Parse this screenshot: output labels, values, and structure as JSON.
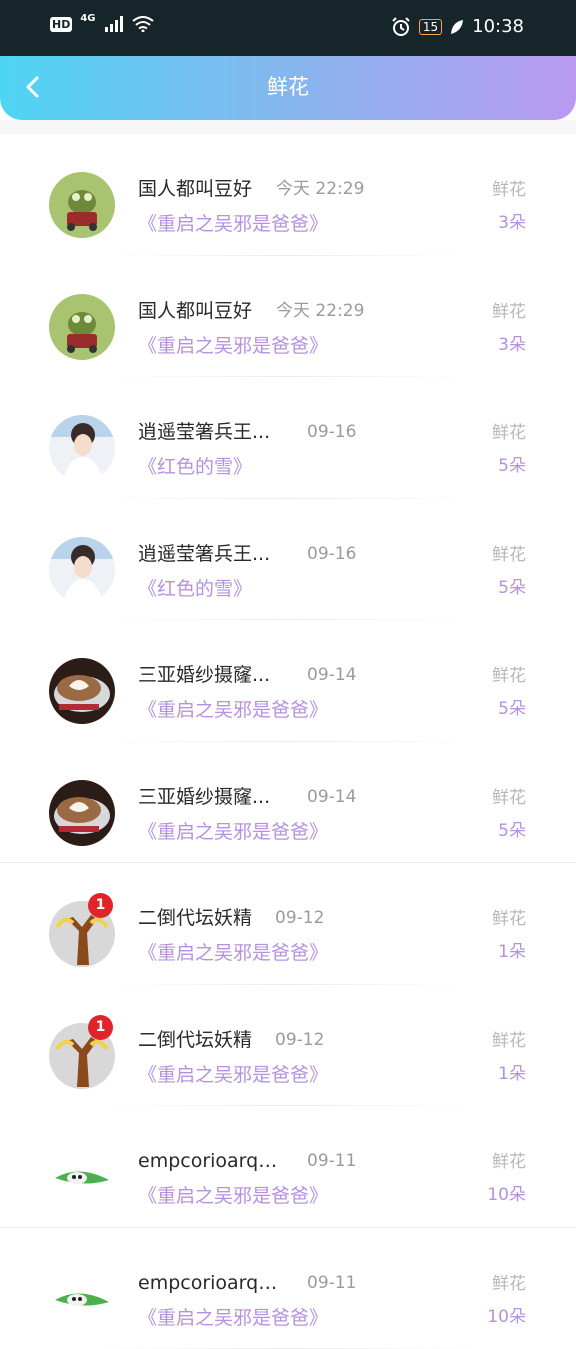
{
  "status_bar": {
    "left_badges": [
      "HD",
      "4G"
    ],
    "battery": "15",
    "time": "10:38"
  },
  "header": {
    "title": "鲜花"
  },
  "list": [
    {
      "name": "国人都叫豆好",
      "time": "今天 22:29",
      "book": "《重启之吴邪是爸爸》",
      "label": "鲜花",
      "count": "3朵",
      "avatar": "frog-avatar"
    },
    {
      "name": "国人都叫豆好",
      "time": "今天 22:29",
      "book": "《重启之吴邪是爸爸》",
      "label": "鲜花",
      "count": "3朵",
      "avatar": "frog-avatar"
    },
    {
      "name": "逍遥莹箸兵王...",
      "time": "09-16",
      "book": "《红色的雪》",
      "label": "鲜花",
      "count": "5朵",
      "avatar": "girl-avatar"
    },
    {
      "name": "逍遥莹箸兵王...",
      "time": "09-16",
      "book": "《红色的雪》",
      "label": "鲜花",
      "count": "5朵",
      "avatar": "girl-avatar"
    },
    {
      "name": "三亚婚纱摄窿...",
      "time": "09-14",
      "book": "《重启之吴邪是爸爸》",
      "label": "鲜花",
      "count": "5朵",
      "avatar": "coffee-avatar"
    },
    {
      "name": "三亚婚纱摄窿...",
      "time": "09-14",
      "book": "《重启之吴邪是爸爸》",
      "label": "鲜花",
      "count": "5朵",
      "avatar": "coffee-avatar"
    },
    {
      "name": "二倒代坛妖精",
      "time": "09-12",
      "book": "《重启之吴邪是爸爸》",
      "label": "鲜花",
      "count": "1朵",
      "avatar": "tree-avatar",
      "badge": "1"
    },
    {
      "name": "二倒代坛妖精",
      "time": "09-12",
      "book": "《重启之吴邪是爸爸》",
      "label": "鲜花",
      "count": "1朵",
      "avatar": "tree-avatar",
      "badge": "1"
    },
    {
      "name": "empcorioarqr...",
      "time": "09-11",
      "book": "《重启之吴邪是爸爸》",
      "label": "鲜花",
      "count": "10朵",
      "avatar": "leaf-avatar"
    },
    {
      "name": "empcorioarqr...",
      "time": "09-11",
      "book": "《重启之吴邪是爸爸》",
      "label": "鲜花",
      "count": "10朵",
      "avatar": "leaf-avatar"
    }
  ],
  "colors": {
    "accent_purple": "#b692dd",
    "gradient_start": "#4fd5f4",
    "gradient_end": "#b99af0"
  }
}
